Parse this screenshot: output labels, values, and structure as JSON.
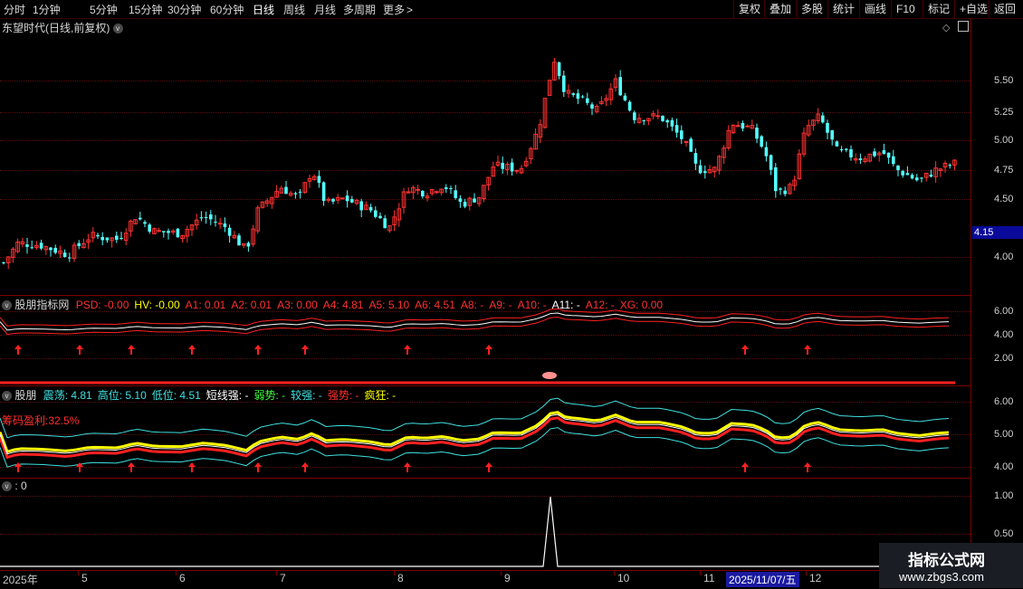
{
  "toolbar": {
    "periods": [
      "分时",
      "1分钟",
      "5分钟",
      "15分钟",
      "30分钟",
      "60分钟",
      "日线",
      "周线",
      "月线",
      "多周期",
      "更多"
    ],
    "active_period": "日线",
    "more_arrow": ">",
    "right_buttons": [
      "复权",
      "叠加",
      "多股",
      "统计",
      "画线",
      "F10",
      "标记",
      "+自选",
      "返回"
    ]
  },
  "main": {
    "title": "东望时代(日线,前复权)",
    "y_labels": [
      "5.50",
      "5.25",
      "5.00",
      "4.75",
      "4.50",
      "4.15",
      "4.00"
    ],
    "current_price": "4.15"
  },
  "ind1": {
    "name": "股朋指标网",
    "values": [
      {
        "text": "PSD: -0.00",
        "color": "#ff3030"
      },
      {
        "text": "HV: -0.00",
        "color": "#ffff00"
      },
      {
        "text": "A1: 0.01",
        "color": "#ff3030"
      },
      {
        "text": "A2: 0.01",
        "color": "#ff3030"
      },
      {
        "text": "A3: 0.00",
        "color": "#ff3030"
      },
      {
        "text": "A4: 4.81",
        "color": "#ff3030"
      },
      {
        "text": "A5: 5.10",
        "color": "#ff3030"
      },
      {
        "text": "A6: 4.51",
        "color": "#ff3030"
      },
      {
        "text": "A8: -",
        "color": "#ff3030"
      },
      {
        "text": "A9: -",
        "color": "#ff3030"
      },
      {
        "text": "A10: -",
        "color": "#ff3030"
      },
      {
        "text": "A11: -",
        "color": "#ffffff"
      },
      {
        "text": "A12: -",
        "color": "#ff3030"
      },
      {
        "text": "XG: 0.00",
        "color": "#ff3030"
      }
    ],
    "y_labels": [
      "6.00",
      "4.00",
      "2.00"
    ]
  },
  "ind2": {
    "name": "股朋",
    "values": [
      {
        "text": "震荡: 4.81",
        "color": "#40e0e0"
      },
      {
        "text": "高位: 5.10",
        "color": "#40e0e0"
      },
      {
        "text": "低位: 4.51",
        "color": "#40e0e0"
      },
      {
        "text": "短线强: -",
        "color": "#ffffff"
      },
      {
        "text": "弱势: -",
        "color": "#40ff40"
      },
      {
        "text": "较强: -",
        "color": "#40e0e0"
      },
      {
        "text": "强势: -",
        "color": "#ff3030"
      },
      {
        "text": "疯狂: -",
        "color": "#ffff00"
      }
    ],
    "chip_profit": "筹码盈利:32.5%",
    "y_labels": [
      "6.00",
      "5.00",
      "4.00"
    ]
  },
  "ind3": {
    "name": ": 0",
    "y_labels": [
      "1.00",
      "0.50"
    ]
  },
  "date_axis": {
    "labels": [
      "2025年",
      "5",
      "6",
      "7",
      "8",
      "9",
      "10",
      "11",
      "12"
    ],
    "cursor_date": "2025/11/07/五"
  },
  "logo": {
    "name": "指标公式网",
    "url": "www.zbgs3.com"
  },
  "colors": {
    "up": "#ff3232",
    "down": "#54ffff",
    "grid": "#5a1010",
    "border": "#7a0000"
  },
  "icons": [
    "chevron-down-icon",
    "diamond-icon",
    "window-toggle-icon",
    "up-arrow-signal-icon"
  ]
}
